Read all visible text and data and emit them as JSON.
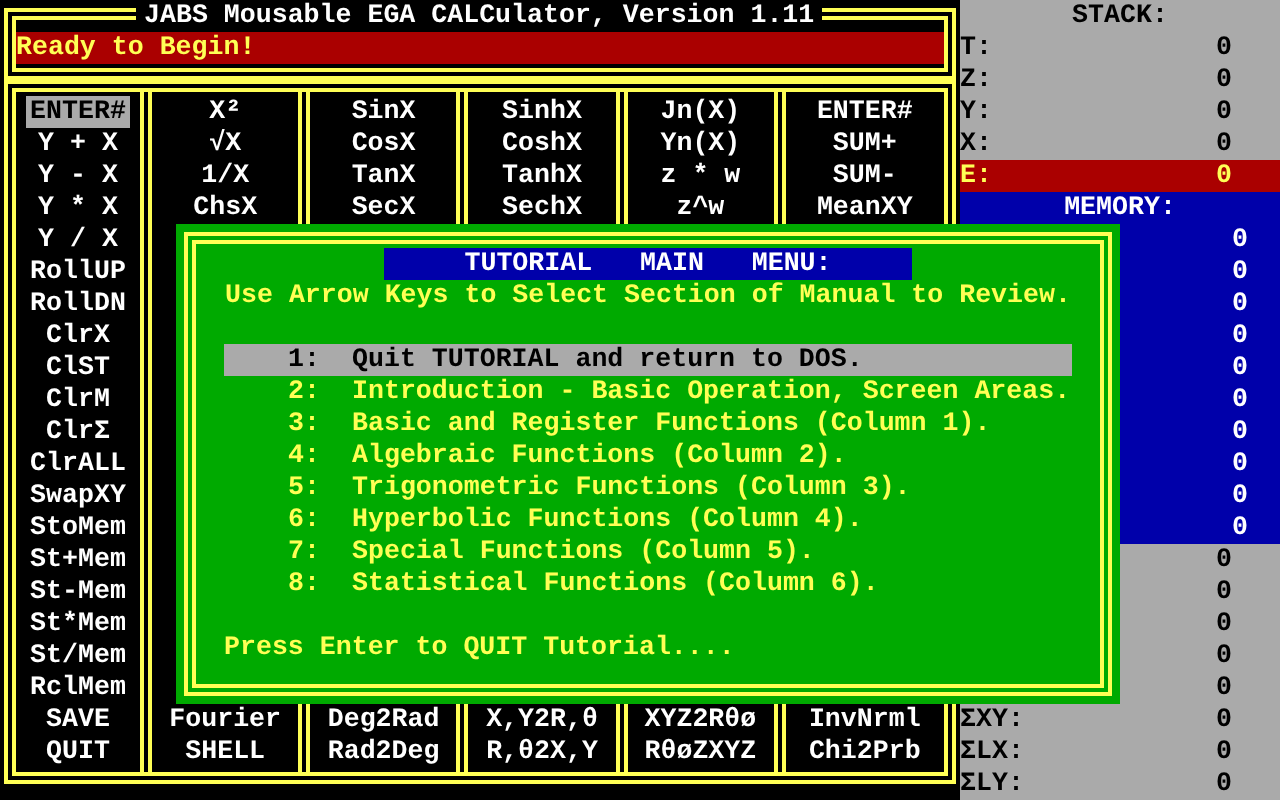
{
  "window": {
    "title": "JABS Mousable EGA CALCulator, Version 1.11"
  },
  "status": "Ready to Begin!",
  "key_columns": [
    {
      "top": [
        {
          "label": "ENTER#",
          "selected": true
        },
        {
          "label": "Y + X",
          "selected": false
        },
        {
          "label": "Y - X",
          "selected": false
        },
        {
          "label": "Y * X",
          "selected": false
        },
        {
          "label": "Y / X",
          "selected": false
        },
        {
          "label": "RollUP",
          "selected": false
        },
        {
          "label": "RollDN",
          "selected": false
        },
        {
          "label": "ClrX",
          "selected": false
        },
        {
          "label": "ClST",
          "selected": false
        },
        {
          "label": "ClrM",
          "selected": false
        },
        {
          "label": "ClrΣ",
          "selected": false
        },
        {
          "label": "ClrALL",
          "selected": false
        },
        {
          "label": "SwapXY",
          "selected": false
        },
        {
          "label": "StoMem",
          "selected": false
        },
        {
          "label": "St+Mem",
          "selected": false
        },
        {
          "label": "St-Mem",
          "selected": false
        },
        {
          "label": "St*Mem",
          "selected": false
        },
        {
          "label": "St/Mem",
          "selected": false
        },
        {
          "label": "RclMem",
          "selected": false
        },
        {
          "label": "SAVE",
          "selected": false
        },
        {
          "label": "QUIT",
          "selected": false
        }
      ]
    },
    {
      "top": [
        {
          "label": "X²",
          "selected": false
        },
        {
          "label": "√X",
          "selected": false
        },
        {
          "label": "1/X",
          "selected": false
        },
        {
          "label": "ChsX",
          "selected": false
        }
      ],
      "bottom": [
        {
          "label": "Fourier",
          "selected": false
        },
        {
          "label": "SHELL",
          "selected": false
        }
      ]
    },
    {
      "top": [
        {
          "label": "SinX",
          "selected": false
        },
        {
          "label": "CosX",
          "selected": false
        },
        {
          "label": "TanX",
          "selected": false
        },
        {
          "label": "SecX",
          "selected": false
        }
      ],
      "bottom": [
        {
          "label": "Deg2Rad",
          "selected": false
        },
        {
          "label": "Rad2Deg",
          "selected": false
        }
      ]
    },
    {
      "top": [
        {
          "label": "SinhX",
          "selected": false
        },
        {
          "label": "CoshX",
          "selected": false
        },
        {
          "label": "TanhX",
          "selected": false
        },
        {
          "label": "SechX",
          "selected": false
        }
      ],
      "bottom": [
        {
          "label": "X,Y2R,θ",
          "selected": false
        },
        {
          "label": "R,θ2X,Y",
          "selected": false
        }
      ]
    },
    {
      "top": [
        {
          "label": "Jn(X)",
          "selected": false
        },
        {
          "label": "Yn(X)",
          "selected": false
        },
        {
          "label": "z * w",
          "selected": false
        },
        {
          "label": "z^w",
          "selected": false
        }
      ],
      "bottom": [
        {
          "label": "XYZ2Rθø",
          "selected": false
        },
        {
          "label": "RθøZXYZ",
          "selected": false
        }
      ]
    },
    {
      "top": [
        {
          "label": "ENTER#",
          "selected": false
        },
        {
          "label": "SUM+",
          "selected": false
        },
        {
          "label": "SUM-",
          "selected": false
        },
        {
          "label": "MeanXY",
          "selected": false
        }
      ],
      "bottom": [
        {
          "label": "InvNrml",
          "selected": false
        },
        {
          "label": "Chi2Prb",
          "selected": false
        }
      ]
    }
  ],
  "stack": {
    "title": "STACK:",
    "rows": [
      {
        "label": "T:",
        "value": "0",
        "highlighted": false
      },
      {
        "label": "Z:",
        "value": "0",
        "highlighted": false
      },
      {
        "label": "Y:",
        "value": "0",
        "highlighted": false
      },
      {
        "label": "X:",
        "value": "0",
        "highlighted": false
      },
      {
        "label": "E:",
        "value": "0",
        "highlighted": true
      }
    ]
  },
  "memory": {
    "title": "MEMORY:",
    "values": [
      "0",
      "0",
      "0",
      "0",
      "0",
      "0",
      "0",
      "0",
      "0",
      "0"
    ]
  },
  "statistics": [
    {
      "value": "0"
    },
    {
      "value": "0"
    },
    {
      "value": "0"
    },
    {
      "value": "0"
    },
    {
      "value": "0"
    },
    {
      "label": "ΣXY:",
      "value": "0"
    },
    {
      "label": "ΣLX:",
      "value": "0"
    },
    {
      "label": "ΣLY:",
      "value": "0"
    }
  ],
  "dialog": {
    "title": "TUTORIAL   MAIN   MENU:",
    "instruction": "Use Arrow Keys to Select Section of Manual to Review.",
    "items": [
      {
        "number": "1:",
        "label": "Quit TUTORIAL and return to DOS.",
        "selected": true
      },
      {
        "number": "2:",
        "label": "Introduction - Basic Operation, Screen Areas.",
        "selected": false
      },
      {
        "number": "3:",
        "label": "Basic and Register Functions (Column 1).",
        "selected": false
      },
      {
        "number": "4:",
        "label": "Algebraic Functions (Column 2).",
        "selected": false
      },
      {
        "number": "5:",
        "label": "Trigonometric Functions (Column 3).",
        "selected": false
      },
      {
        "number": "6:",
        "label": "Hyperbolic Functions (Column 4).",
        "selected": false
      },
      {
        "number": "7:",
        "label": "Special Functions (Column 5).",
        "selected": false
      },
      {
        "number": "8:",
        "label": "Statistical Functions (Column 6).",
        "selected": false
      }
    ],
    "footer": "Press Enter to QUIT Tutorial...."
  }
}
